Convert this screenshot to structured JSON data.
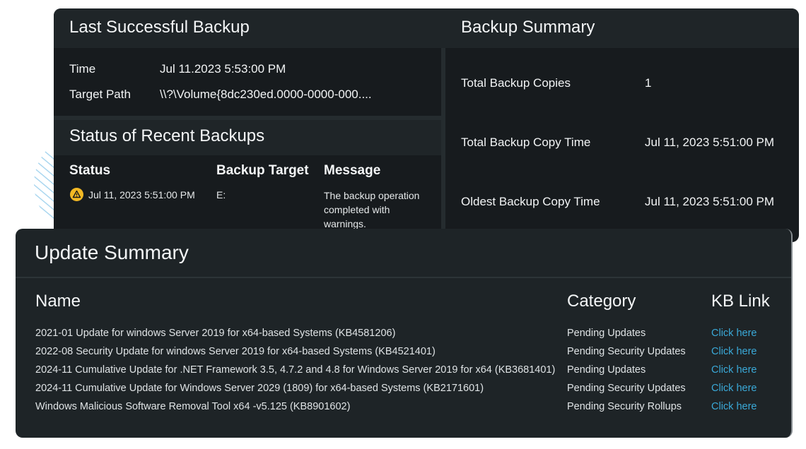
{
  "last_successful_backup": {
    "title": "Last Successful Backup",
    "time_label": "Time",
    "time_value": "Jul 11.2023 5:53:00 PM",
    "target_path_label": "Target Path",
    "target_path_value": "\\\\?\\Volume{8dc230ed.0000-0000-000...."
  },
  "recent_backups": {
    "title": "Status of Recent Backups",
    "columns": [
      "Status",
      "Backup Target",
      "Message"
    ],
    "rows": [
      {
        "status_icon": "warning-icon",
        "status_time": "Jul 11, 2023 5:51:00 PM",
        "target": "E:",
        "message": "The backup operation completed with warnings."
      }
    ]
  },
  "backup_summary": {
    "title": "Backup  Summary",
    "items": [
      {
        "label": "Total Backup Copies",
        "value": "1"
      },
      {
        "label": "Total Backup Copy Time",
        "value": "Jul 11, 2023 5:51:00 PM"
      },
      {
        "label": "Oldest Backup Copy Time",
        "value": "Jul 11, 2023 5:51:00 PM"
      }
    ]
  },
  "update_summary": {
    "title": "Update Summary",
    "columns": [
      "Name",
      "Category",
      "KB Link"
    ],
    "rows": [
      {
        "name": "2021-01 Update for windows Server 2019 for x64-based Systems (KB4581206)",
        "category": "Pending Updates",
        "link": "Click here"
      },
      {
        "name": "2022-08 Security Update for windows Server 2019 for x64-based Systems (KB4521401)",
        "category": "Pending Security Updates",
        "link": "Click here"
      },
      {
        "name": "2024-11 Cumulative Update for .NET Framework 3.5, 4.7.2 and 4.8 for Windows Server 2019 for x64 (KB3681401)",
        "category": "Pending Updates",
        "link": "Click here"
      },
      {
        "name": "2024-11 Cumulative Update for Windows Server 2029 (1809) for x64-based Systems (KB2171601)",
        "category": "Pending Security Updates",
        "link": "Click here"
      },
      {
        "name": "Windows Malicious Software Removal Tool x64 -v5.125 (KB8901602)",
        "category": "Pending Security Rollups",
        "link": "Click here"
      }
    ]
  },
  "colors": {
    "warning": "#f2b824",
    "link": "#3aa9d8",
    "card_header": "#1f2528",
    "card_body": "#171b1e"
  }
}
